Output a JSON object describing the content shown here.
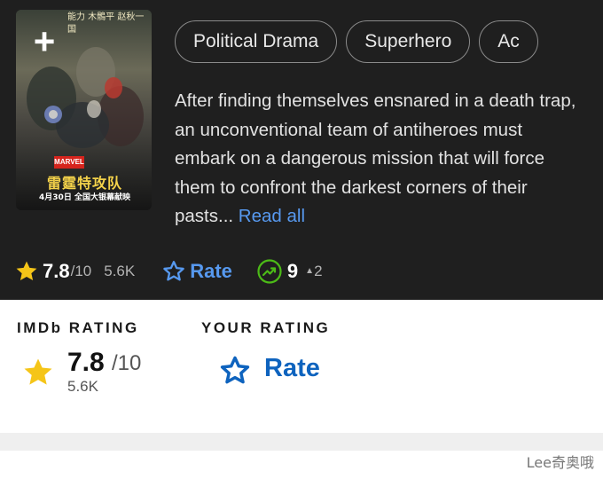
{
  "poster": {
    "add_icon": "plus-icon",
    "top_text": "能力 木鶻平 赵秋一 国",
    "badge": "MARVEL",
    "title_cn": "雷霆特攻队",
    "date_cn": "4月30日 全国大银幕献映"
  },
  "genres": [
    "Political Drama",
    "Superhero",
    "Ac"
  ],
  "description": {
    "text": "After finding themselves ensnared in a death trap, an unconventional team of antiheroes must embark on a dangerous mission that will force them to confront the darkest corners of their pasts...",
    "read_all": "Read all"
  },
  "metrics": {
    "score": "7.8",
    "out_of": "/10",
    "votes": "5.6K",
    "rate_label": "Rate",
    "popularity": "9",
    "popularity_delta": "2"
  },
  "imdb_rating": {
    "header": "IMDb RATING",
    "score": "7.8",
    "out_of": "/10",
    "votes": "5.6K"
  },
  "your_rating": {
    "header": "YOUR RATING",
    "label": "Rate"
  },
  "watermark": "Lee奇奥哦",
  "colors": {
    "dark_bg": "#1f1f1f",
    "imdb_star": "#f5c518",
    "link_blue": "#5799ef",
    "rate_blue": "#0e63be",
    "trend_green": "#4cbb17"
  }
}
